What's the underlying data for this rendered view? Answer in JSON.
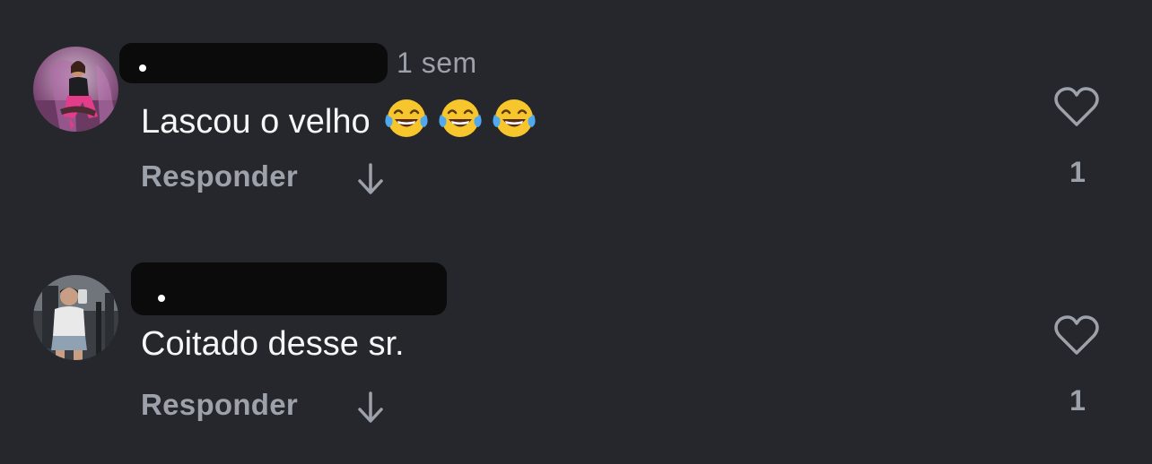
{
  "comments": [
    {
      "time": "1 sem",
      "text": "Lascou o velho",
      "emojis": [
        "face-with-tears-of-joy",
        "face-with-tears-of-joy",
        "face-with-tears-of-joy"
      ],
      "reply_label": "Responder",
      "likes": "1",
      "avatar": "avatar-woman-pink-outfit"
    },
    {
      "time": "",
      "text": "Coitado desse sr.",
      "emojis": [],
      "reply_label": "Responder",
      "likes": "1",
      "avatar": "avatar-man-mirror-selfie"
    }
  ],
  "colors": {
    "background": "#25272c",
    "muted_text": "#9da1aa",
    "primary_text": "#f5f6f7",
    "redaction": "#0b0b0c"
  }
}
